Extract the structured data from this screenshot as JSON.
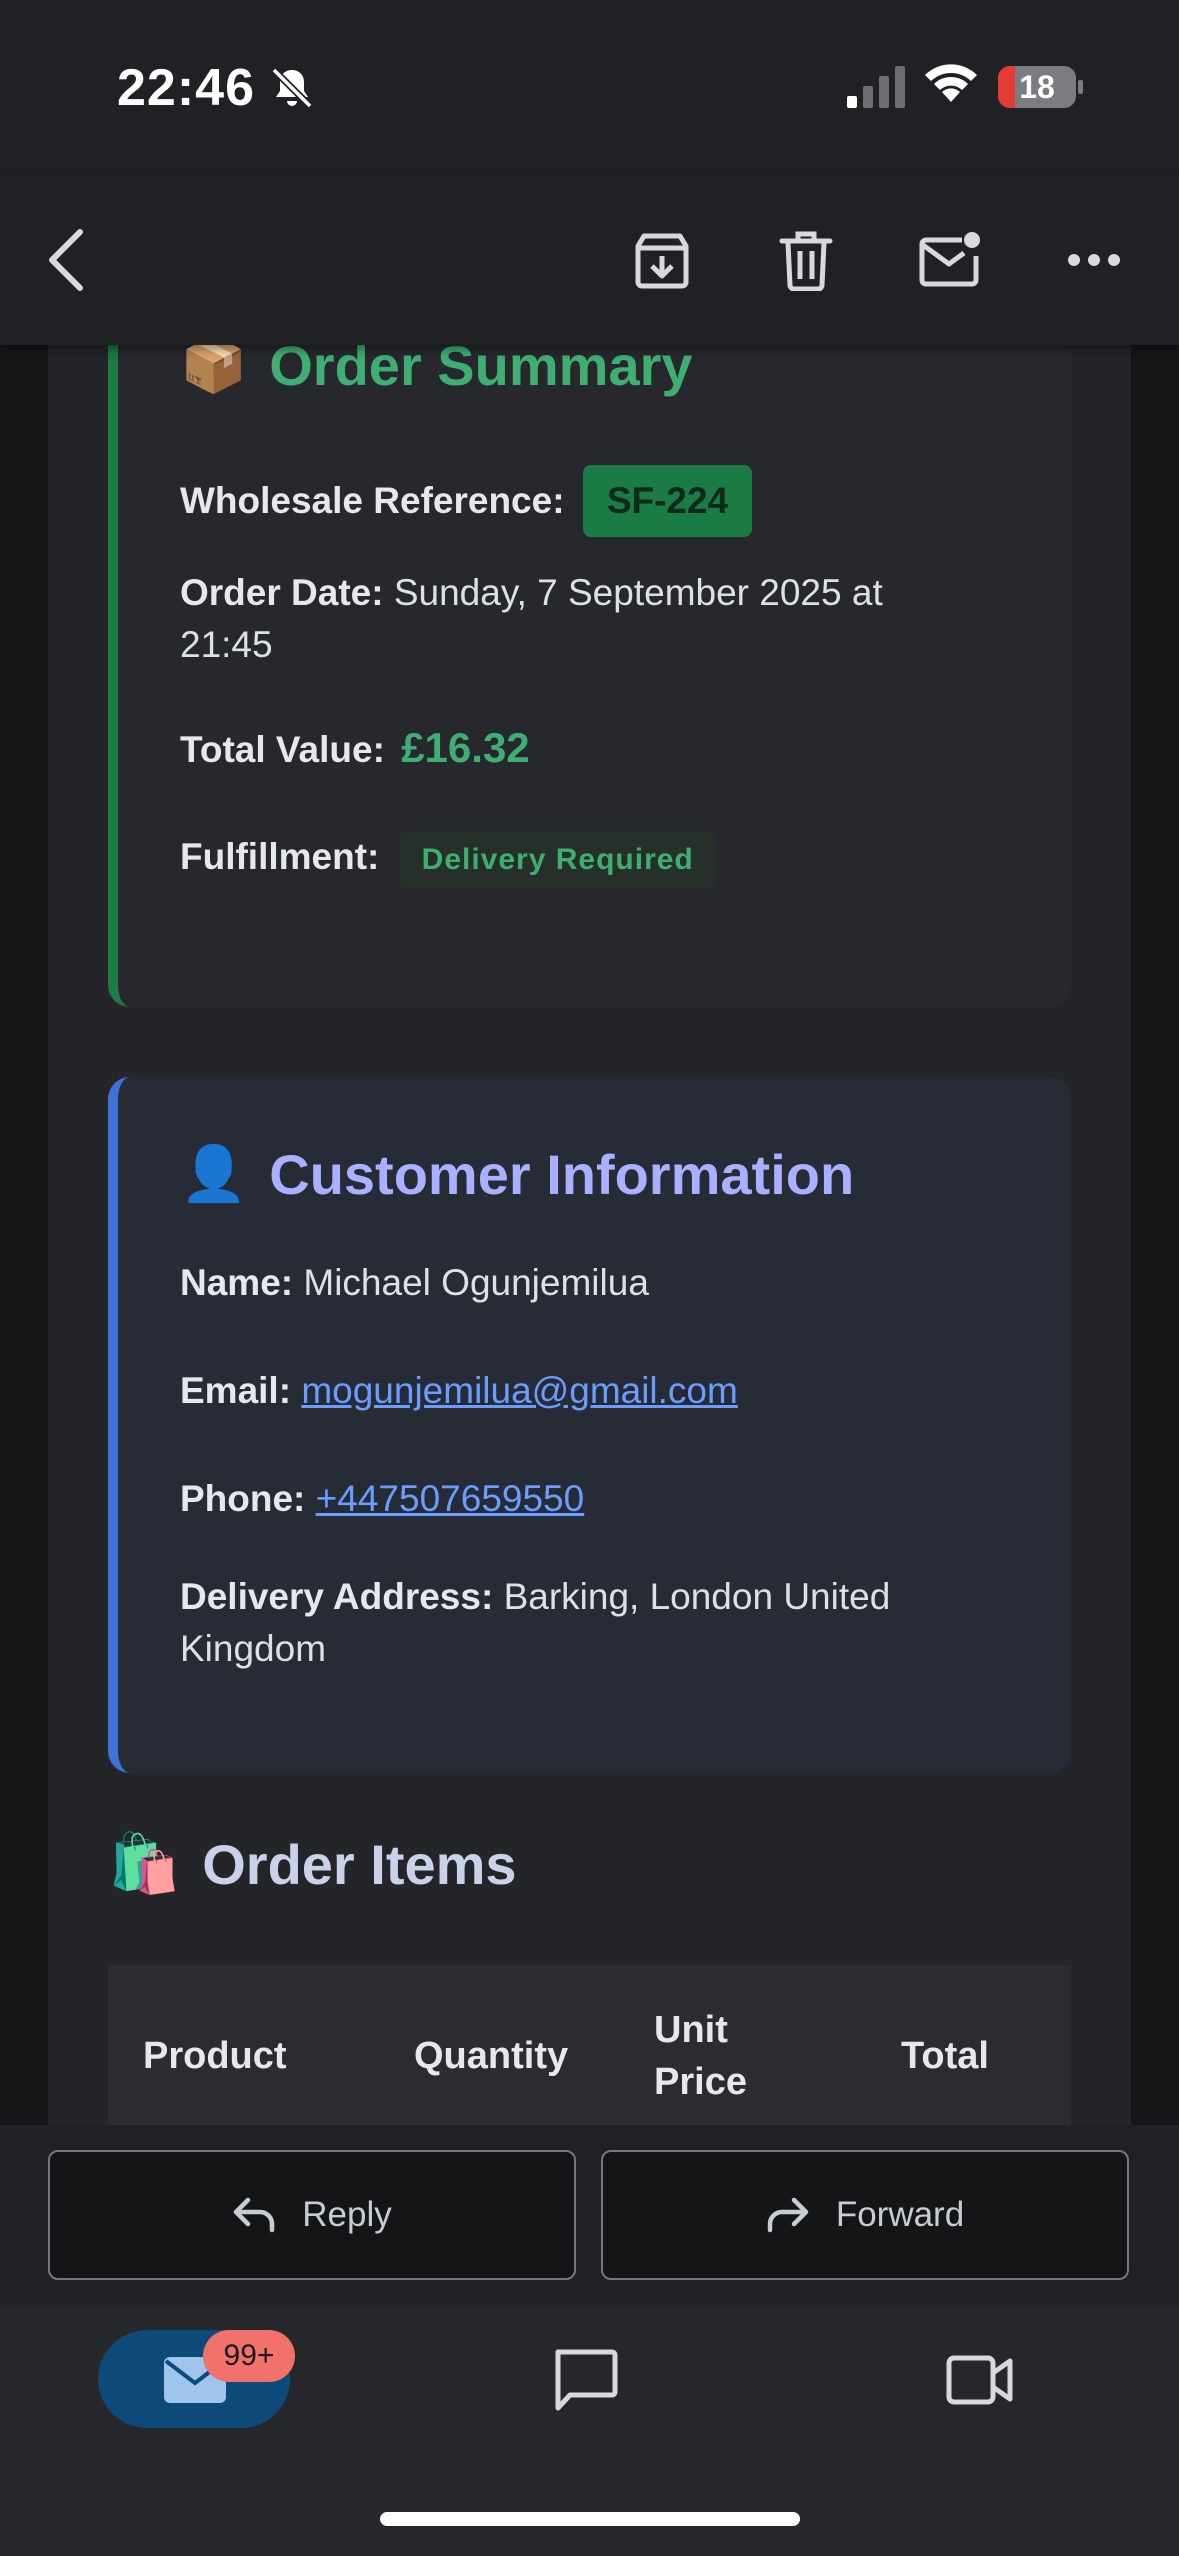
{
  "status_bar": {
    "time": "22:46",
    "battery_level": "18",
    "icons": [
      "bell-off-icon",
      "cellular-signal-icon",
      "wifi-icon",
      "battery-icon"
    ]
  },
  "toolbar": {
    "icons": [
      "back-chevron-icon",
      "archive-icon",
      "trash-icon",
      "mark-unread-icon",
      "more-options-icon"
    ]
  },
  "order_summary": {
    "emoji": "📦",
    "title": "Order Summary",
    "reference_label": "Wholesale Reference:",
    "reference_value": "SF-224",
    "date_label": "Order Date:",
    "date_value": "Sunday, 7 September 2025 at",
    "date_value_line2": "21:45",
    "total_label": "Total Value:",
    "total_value": "£16.32",
    "fulfillment_label": "Fulfillment:",
    "fulfillment_value": "Delivery Required"
  },
  "customer": {
    "emoji": "👤",
    "title": "Customer Information",
    "name_label": "Name:",
    "name_value": "Michael Ogunjemilua",
    "email_label": "Email:",
    "email_value": "mogunjemilua@gmail.com",
    "phone_label": "Phone:",
    "phone_value": "+447507659550",
    "address_label": "Delivery Address:",
    "address_value": "Barking, London United",
    "address_value_line2": "Kingdom"
  },
  "order_items": {
    "emoji": "🛍️",
    "title": "Order Items",
    "columns": [
      "Product",
      "Quantity",
      "Unit Price",
      "Total"
    ],
    "unit_price_line1": "Unit",
    "unit_price_line2": "Price"
  },
  "actions": {
    "reply_label": "Reply",
    "forward_label": "Forward"
  },
  "bottom_nav": {
    "mail_badge": "99+",
    "items": [
      "mail-icon",
      "chat-icon",
      "video-icon"
    ]
  },
  "colors": {
    "order_accent": "#1f7a45",
    "order_title": "#3fae72",
    "customer_accent": "#3f72d6",
    "customer_title": "#aab0ff",
    "link": "#6b9cff",
    "badge": "#f1716b"
  }
}
